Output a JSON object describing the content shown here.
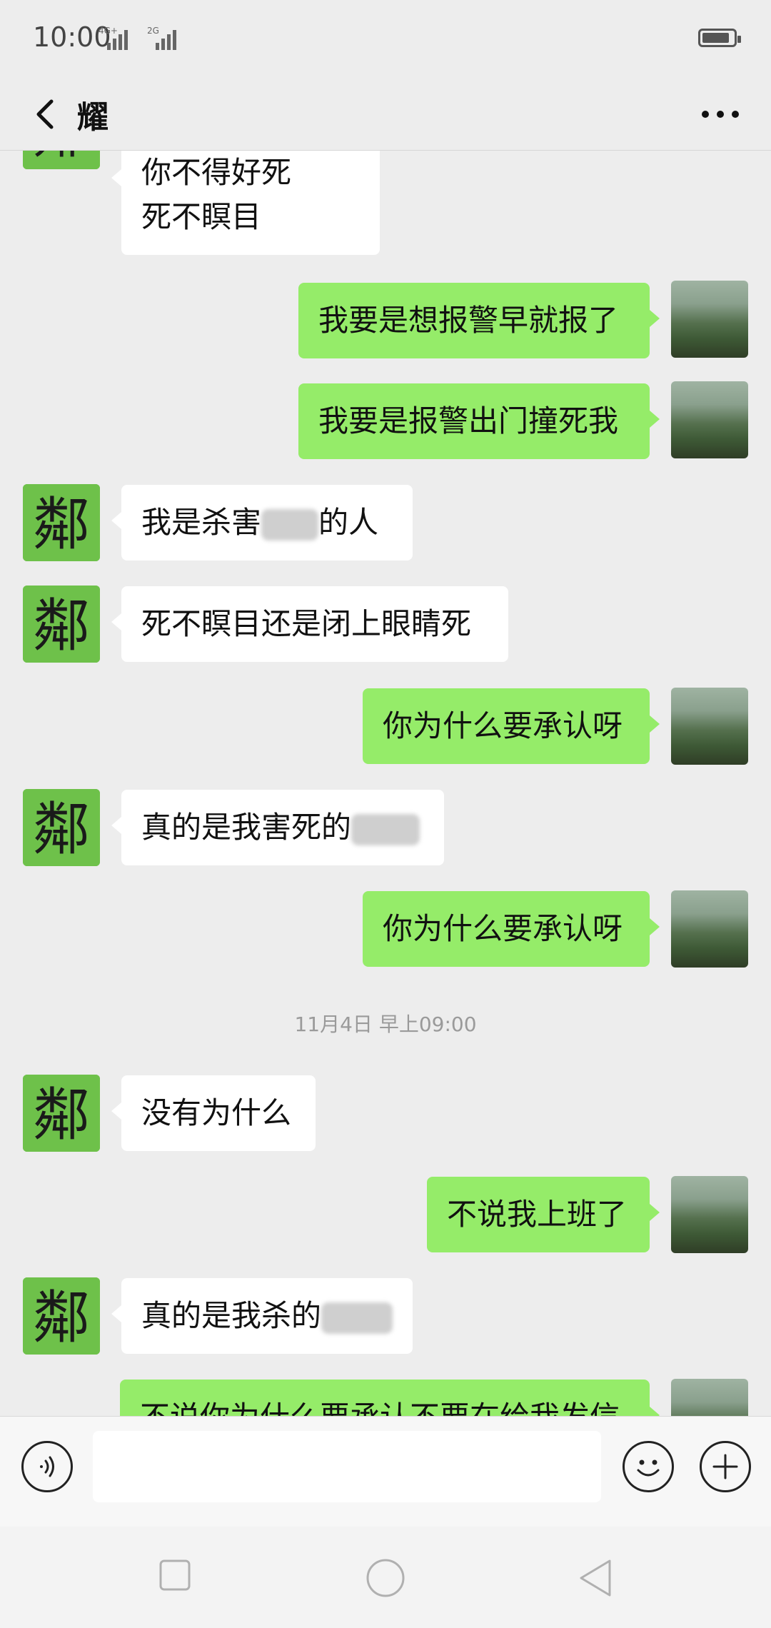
{
  "status_bar": {
    "time": "10:00",
    "network_1": "4G+",
    "network_2": "2G"
  },
  "header": {
    "title": "耀"
  },
  "messages": {
    "m1": {
      "line1": "你不得好死",
      "line2": "死不瞑目"
    },
    "m2": "我要是想报警早就报了",
    "m3": "我要是报警出门撞死我",
    "m4": {
      "before": "我是杀害",
      "after": "的人"
    },
    "m5": "死不瞑目还是闭上眼睛死",
    "m6": "你为什么要承认呀",
    "m7": {
      "before": "真的是我害死的"
    },
    "m8": "你为什么要承认呀",
    "m9": "没有为什么",
    "m10": "不说我上班了",
    "m11": {
      "before": "真的是我杀的"
    },
    "m12": "不说你为什么要承认不要在给我发信"
  },
  "timestamp": "11月4日 早上09:00",
  "avatar_left_char": "鄰",
  "colors": {
    "bubble_out": "#95ec69",
    "bubble_in": "#ffffff",
    "background": "#ededed"
  }
}
